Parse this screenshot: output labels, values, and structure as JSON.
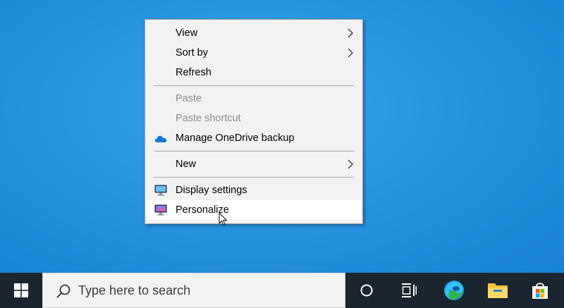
{
  "context_menu": {
    "items": [
      {
        "label": "View",
        "has_submenu": true,
        "enabled": true
      },
      {
        "label": "Sort by",
        "has_submenu": true,
        "enabled": true
      },
      {
        "label": "Refresh",
        "has_submenu": false,
        "enabled": true
      },
      {
        "label": "Paste",
        "has_submenu": false,
        "enabled": false
      },
      {
        "label": "Paste shortcut",
        "has_submenu": false,
        "enabled": false
      },
      {
        "label": "Manage OneDrive backup",
        "icon": "onedrive-cloud-icon",
        "enabled": true
      },
      {
        "label": "New",
        "has_submenu": true,
        "enabled": true
      },
      {
        "label": "Display settings",
        "icon": "display-monitor-icon",
        "enabled": true
      },
      {
        "label": "Personalize",
        "icon": "personalize-monitor-icon",
        "enabled": true,
        "hovered": true
      }
    ]
  },
  "taskbar": {
    "search_placeholder": "Type here to search",
    "icons": [
      "windows-start-icon",
      "search-icon",
      "cortana-icon",
      "task-view-icon",
      "edge-icon",
      "file-explorer-icon",
      "microsoft-store-icon"
    ]
  },
  "colors": {
    "desktop": "#1f8ad9",
    "menu_bg": "#f2f2f2",
    "taskbar": "#1b2530",
    "onedrive": "#0f78d4"
  }
}
